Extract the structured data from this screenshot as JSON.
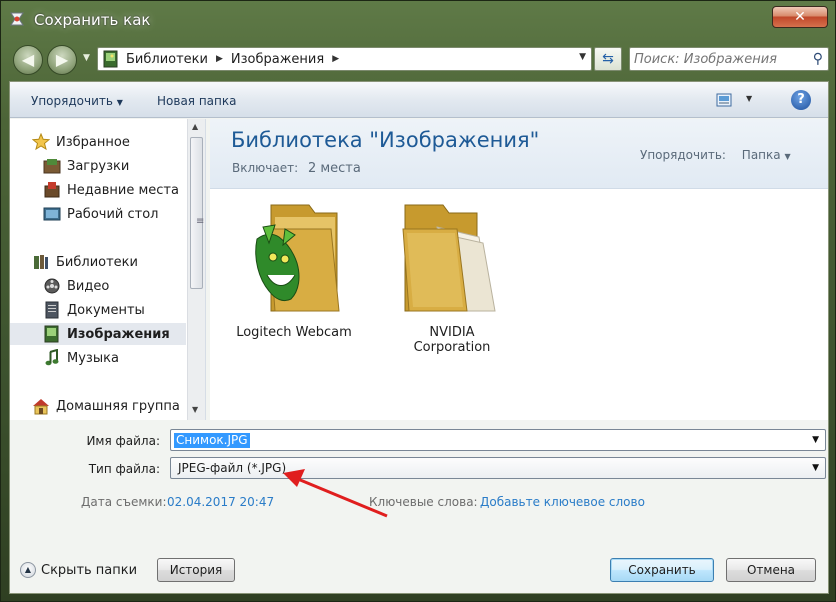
{
  "window": {
    "title": "Сохранить как",
    "close_label": "✕"
  },
  "address_bar": {
    "crumbs": [
      "Библиотеки",
      "Изображения"
    ],
    "search_placeholder": "Поиск: Изображения"
  },
  "toolbar": {
    "organize_label": "Упорядочить",
    "new_folder_label": "Новая папка",
    "help_label": "?"
  },
  "sidebar": {
    "favorites": {
      "label": "Избранное",
      "items": [
        "Загрузки",
        "Недавние места",
        "Рабочий стол"
      ]
    },
    "libraries": {
      "label": "Библиотеки",
      "items": [
        "Видео",
        "Документы",
        "Изображения",
        "Музыка"
      ],
      "selected": "Изображения"
    },
    "homegroup": {
      "label": "Домашняя группа"
    }
  },
  "library_header": {
    "title": "Библиотека \"Изображения\"",
    "includes_label": "Включает:",
    "includes_value": "2 места",
    "arrange_label": "Упорядочить:",
    "arrange_value": "Папка"
  },
  "folders": [
    {
      "name": "Logitech Webcam"
    },
    {
      "name": "NVIDIA Corporation"
    }
  ],
  "form": {
    "filename_label": "Имя файла:",
    "filename_value": "Снимок.JPG",
    "filetype_label": "Тип файла:",
    "filetype_value": "JPEG-файл (*.JPG)",
    "date_label": "Дата съемки:",
    "date_value": "02.04.2017 20:47",
    "keywords_label": "Ключевые слова:",
    "keywords_value": "Добавьте ключевое слово"
  },
  "footer": {
    "hide_folders_label": "Скрыть папки",
    "history_label": "История",
    "save_label": "Сохранить",
    "cancel_label": "Отмена"
  },
  "colors": {
    "accent_title": "#1e5a96",
    "link": "#2a7cc8",
    "selection": "#3399ff",
    "annotation_arrow": "#e01e1e"
  }
}
